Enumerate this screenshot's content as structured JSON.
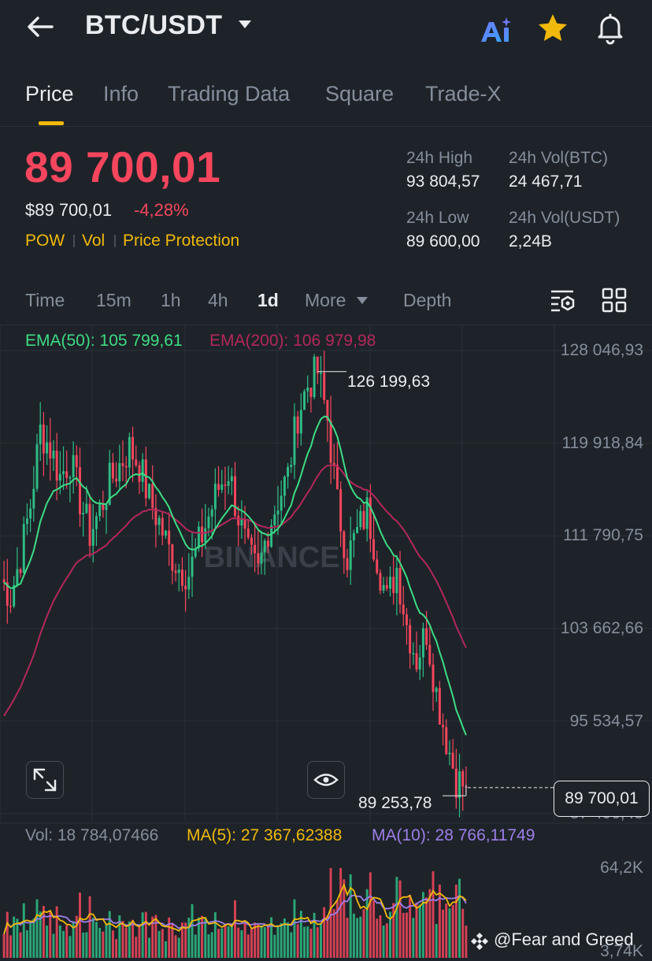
{
  "header": {
    "pair": "BTC/USDT",
    "icons": [
      "back-arrow-icon",
      "ai-icon",
      "star-icon",
      "bell-icon"
    ],
    "star_color": "#f0b90b"
  },
  "tabs": [
    {
      "label": "Price",
      "active": true
    },
    {
      "label": "Info"
    },
    {
      "label": "Trading Data"
    },
    {
      "label": "Square"
    },
    {
      "label": "Trade-X"
    }
  ],
  "price": {
    "last": "89 700,01",
    "usd": "$89 700,01",
    "change_pct": "-4,28%",
    "color": "#f6465d",
    "tags": [
      "POW",
      "Vol",
      "Price Protection"
    ]
  },
  "stats": {
    "high_label": "24h High",
    "high_value": "93 804,57",
    "low_label": "24h Low",
    "low_value": "89 600,00",
    "vol_btc_label": "24h Vol(BTC)",
    "vol_btc_value": "24 467,71",
    "vol_usdt_label": "24h Vol(USDT)",
    "vol_usdt_value": "2,24B"
  },
  "intervals": {
    "time": "Time",
    "m15": "15m",
    "h1": "1h",
    "h4": "4h",
    "d1": "1d",
    "more": "More",
    "depth": "Depth",
    "selected": "1d"
  },
  "indicators": {
    "ema50": "EMA(50): 105 799,61",
    "ema200": "EMA(200): 106 979,98",
    "vol": "Vol: 18 784,07466",
    "ma5": "MA(5): 27 367,62388",
    "ma10": "MA(10): 28 766,11749"
  },
  "chart": {
    "axis_labels": [
      "128 046,93",
      "119 918,84",
      "111 790,75",
      "103 662,66",
      "95 534,57",
      "87 406,48"
    ],
    "high_marker": "126 199,63",
    "low_marker": "89 253,78",
    "current_price": "89 700,01",
    "vol_axis_top": "64,2K",
    "vol_axis_bottom": "3,74K",
    "watermark_logo": "BINANCE",
    "up_color": "#2ebd85",
    "down_color": "#f6465d",
    "ema50_color": "#3ddc84",
    "ema200_color": "#b3275d"
  },
  "chart_data": {
    "type": "candlestick",
    "interval": "1d",
    "y_axis_ticks": [
      128046.93,
      119918.84,
      111790.75,
      103662.66,
      95534.57,
      87406.48
    ],
    "ylim": [
      86000,
      131000
    ],
    "marked_high": 126199.63,
    "marked_low": 89253.78,
    "last_price": 89700.01,
    "ema50_last": 105799.61,
    "ema200_last": 106979.98,
    "approx_close_path": [
      108000,
      106500,
      110000,
      114500,
      121000,
      119500,
      117000,
      118500,
      115000,
      112000,
      114000,
      116500,
      118000,
      119500,
      118000,
      115000,
      113000,
      110500,
      109000,
      108500,
      111000,
      113500,
      116000,
      117500,
      113500,
      110000,
      108500,
      112500,
      115000,
      117000,
      122500,
      125000,
      126199.63,
      122000,
      114500,
      110000,
      112000,
      114000,
      110000,
      106000,
      109000,
      104000,
      101000,
      103500,
      98000,
      94000,
      90500,
      89700.01
    ]
  },
  "footer": {
    "watermark": "@Fear and Greed"
  }
}
